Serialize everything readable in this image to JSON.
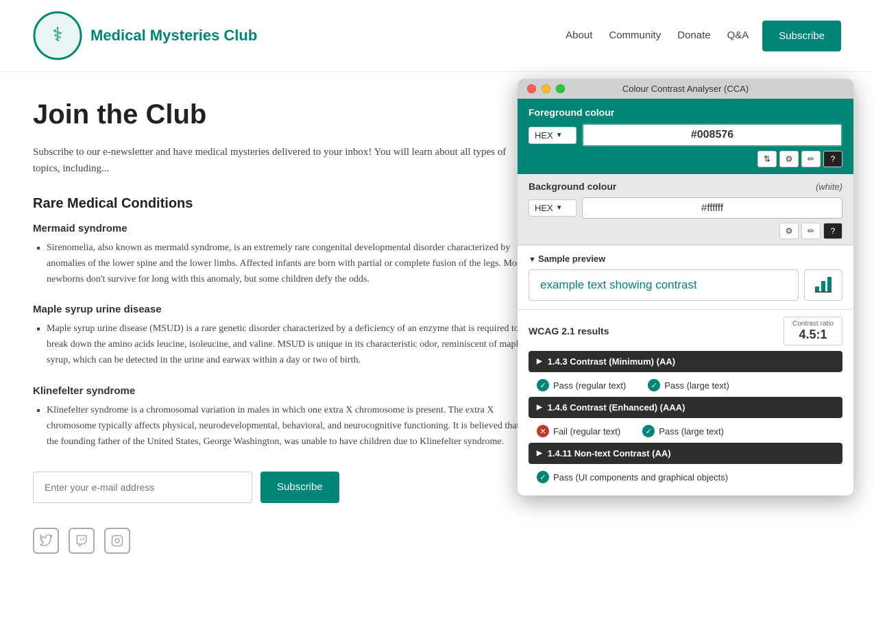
{
  "navbar": {
    "brand": "Medical Mysteries Club",
    "links": [
      "About",
      "Community",
      "Donate",
      "Q&A"
    ],
    "subscribe_label": "Subscribe"
  },
  "hero": {
    "title": "Join the Club",
    "intro": "Subscribe to our e-newsletter and have medical mysteries delivered to your inbox! You will learn about all types of topics, including..."
  },
  "conditions": {
    "section_heading": "Rare Medical Conditions",
    "items": [
      {
        "name": "Mermaid syndrome",
        "description": "Sirenomelia, also known as mermaid syndrome, is an extremely rare congenital developmental disorder characterized by anomalies of the lower spine and the lower limbs. Affected infants are born with partial or complete fusion of the legs. Most newborns don't survive for long with this anomaly, but some children defy the odds."
      },
      {
        "name": "Maple syrup urine disease",
        "description": "Maple syrup urine disease (MSUD) is a rare genetic disorder characterized by a deficiency of an enzyme that is required to break down the amino acids leucine, isoleucine, and valine. MSUD is unique in its characteristic odor, reminiscent of maple syrup, which can be detected in the urine and earwax within a day or two of birth."
      },
      {
        "name": "Klinefelter syndrome",
        "description": "Klinefelter syndrome is a chromosomal variation in males in which one extra X chromosome is present. The extra X chromosome typically affects physical, neurodevelopmental, behavioral, and neurocognitive functioning. It is believed that the founding father of the United States, George Washington, was unable to have children due to Klinefelter syndrome."
      }
    ]
  },
  "email_form": {
    "placeholder": "Enter your e-mail address",
    "subscribe_label": "Subscribe"
  },
  "cca": {
    "title": "Colour Contrast Analyser (CCA)",
    "fg_label": "Foreground colour",
    "fg_format": "HEX",
    "fg_value": "#008576",
    "bg_label": "Background colour",
    "bg_white": "(white)",
    "bg_format": "HEX",
    "bg_value": "#ffffff",
    "preview_label": "Sample preview",
    "preview_text": "example text showing contrast",
    "wcag_label": "WCAG 2.1 results",
    "contrast_label": "Contrast ratio",
    "contrast_value": "4.5:1",
    "results": [
      {
        "id": "1.4.3",
        "name": "1.4.3 Contrast (Minimum) (AA)",
        "pass_regular": true,
        "pass_large": true,
        "pass_regular_label": "Pass (regular text)",
        "pass_large_label": "Pass (large text)"
      },
      {
        "id": "1.4.6",
        "name": "1.4.6 Contrast (Enhanced) (AAA)",
        "pass_regular": false,
        "pass_large": true,
        "fail_regular_label": "Fail (regular text)",
        "pass_large_label": "Pass (large text)"
      },
      {
        "id": "1.4.11",
        "name": "1.4.11 Non-text Contrast (AA)",
        "pass_ui": true,
        "pass_ui_label": "Pass (UI components and graphical objects)"
      }
    ]
  }
}
